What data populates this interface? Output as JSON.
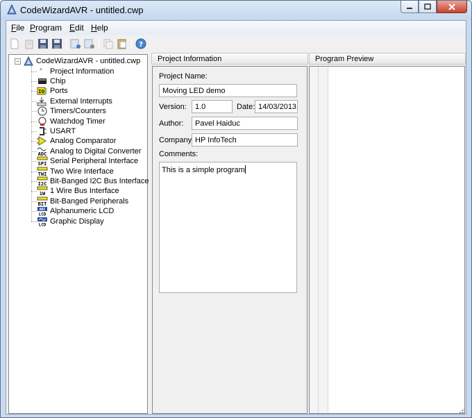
{
  "window": {
    "title": "CodeWizardAVR - untitled.cwp"
  },
  "menu": {
    "file": "File",
    "program": "Program",
    "edit": "Edit",
    "help": "Help"
  },
  "tree": {
    "root": "CodeWizardAVR - untitled.cwp",
    "items": [
      {
        "label": "Project Information",
        "icon": "project-info-icon"
      },
      {
        "label": "Chip",
        "icon": "chip-icon"
      },
      {
        "label": "Ports",
        "icon": "ports-icon"
      },
      {
        "label": "External Interrupts",
        "icon": "external-interrupts-icon"
      },
      {
        "label": "Timers/Counters",
        "icon": "timer-icon"
      },
      {
        "label": "Watchdog Timer",
        "icon": "watchdog-icon"
      },
      {
        "label": "USART",
        "icon": "usart-icon"
      },
      {
        "label": "Analog Comparator",
        "icon": "comparator-icon"
      },
      {
        "label": "Analog to Digital Converter",
        "icon": "adc-icon"
      },
      {
        "label": "Serial Peripheral Interface",
        "icon": "spi-icon"
      },
      {
        "label": "Two Wire Interface",
        "icon": "twi-icon"
      },
      {
        "label": "Bit-Banged I2C Bus Interface",
        "icon": "i2c-icon"
      },
      {
        "label": "1 Wire Bus Interface",
        "icon": "one-wire-icon"
      },
      {
        "label": "Bit-Banged Peripherals",
        "icon": "bit-icon"
      },
      {
        "label": "Alphanumeric LCD",
        "icon": "alpha-lcd-icon"
      },
      {
        "label": "Graphic Display",
        "icon": "graphic-lcd-icon"
      }
    ]
  },
  "panels": {
    "project_info_header": "Project Information",
    "preview_header": "Program Preview"
  },
  "form": {
    "project_name_label": "Project Name:",
    "project_name": "Moving LED demo",
    "version_label": "Version:",
    "version": "1.0",
    "date_label": "Date:",
    "date": "14/03/2013",
    "author_label": "Author:",
    "author": "Pavel Haiduc",
    "company_label": "Company:",
    "company": "HP InfoTech",
    "comments_label": "Comments:",
    "comments": "This is a simple program"
  }
}
